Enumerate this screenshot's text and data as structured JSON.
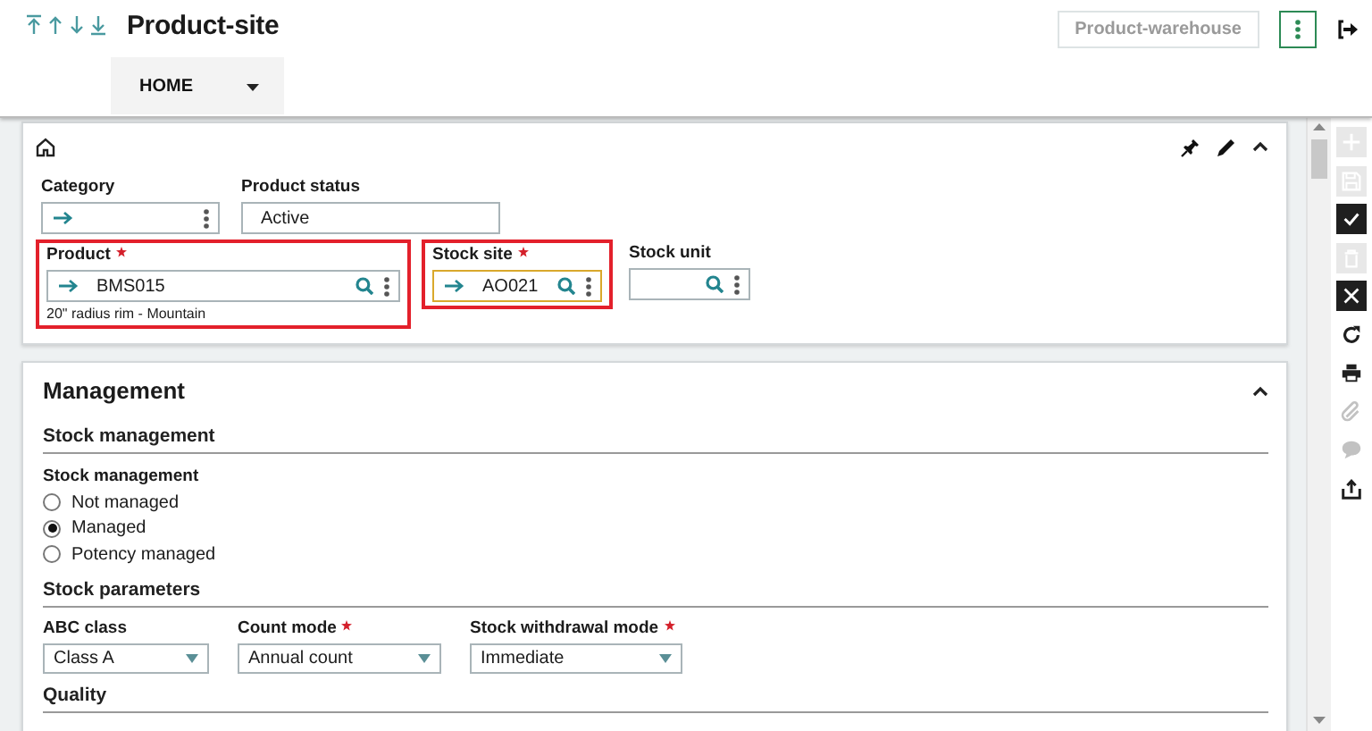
{
  "header": {
    "title": "Product-site",
    "action_button": {
      "label": "Product-warehouse",
      "disabled": true
    }
  },
  "tabs": [
    {
      "label": "HOME",
      "selected": true
    }
  ],
  "identification": {
    "expanded": true,
    "rows": [
      [
        {
          "kind": "link",
          "label": "Category",
          "required": false,
          "highlighted": false,
          "focused": false
        },
        {
          "kind": "text",
          "label": "Product status",
          "required": false,
          "value": "Active",
          "highlighted": false,
          "focused": false
        }
      ],
      [
        {
          "kind": "link_search",
          "label": "Product",
          "required": true,
          "value": "BMS015",
          "note": "20\" radius rim - Mountain",
          "highlighted": true,
          "focused": false
        },
        {
          "kind": "link_search",
          "label": "Stock site",
          "required": true,
          "value": "AO021",
          "highlighted": true,
          "focused": true
        },
        {
          "kind": "search",
          "label": "Stock unit",
          "required": false,
          "highlighted": false,
          "focused": false
        }
      ]
    ]
  },
  "management": {
    "title": "Management",
    "expanded": true,
    "sections": [
      {
        "kind": "radios",
        "title": "Stock management",
        "label": "Stock management",
        "options": [
          {
            "label": "Not managed",
            "selected": false
          },
          {
            "label": "Managed",
            "selected": true
          },
          {
            "label": "Potency managed",
            "selected": false
          }
        ]
      },
      {
        "kind": "selects",
        "title": "Stock parameters",
        "fields": [
          {
            "label": "ABC class",
            "required": false,
            "value": "Class A"
          },
          {
            "label": "Count mode",
            "required": true,
            "value": "Annual count"
          },
          {
            "label": "Stock withdrawal mode",
            "required": true,
            "value": "Immediate"
          }
        ]
      },
      {
        "kind": "empty",
        "title": "Quality"
      }
    ]
  },
  "toolbar": [
    {
      "kind": "add",
      "disabled": true
    },
    {
      "kind": "save",
      "disabled": true
    },
    {
      "kind": "ok",
      "disabled": false
    },
    {
      "kind": "delete",
      "disabled": true
    },
    {
      "kind": "cancel",
      "disabled": false
    },
    {
      "kind": "refresh",
      "disabled": false
    },
    {
      "kind": "print",
      "disabled": false
    },
    {
      "kind": "attach",
      "disabled": true
    },
    {
      "kind": "comment",
      "disabled": true
    },
    {
      "kind": "export",
      "disabled": false
    }
  ]
}
